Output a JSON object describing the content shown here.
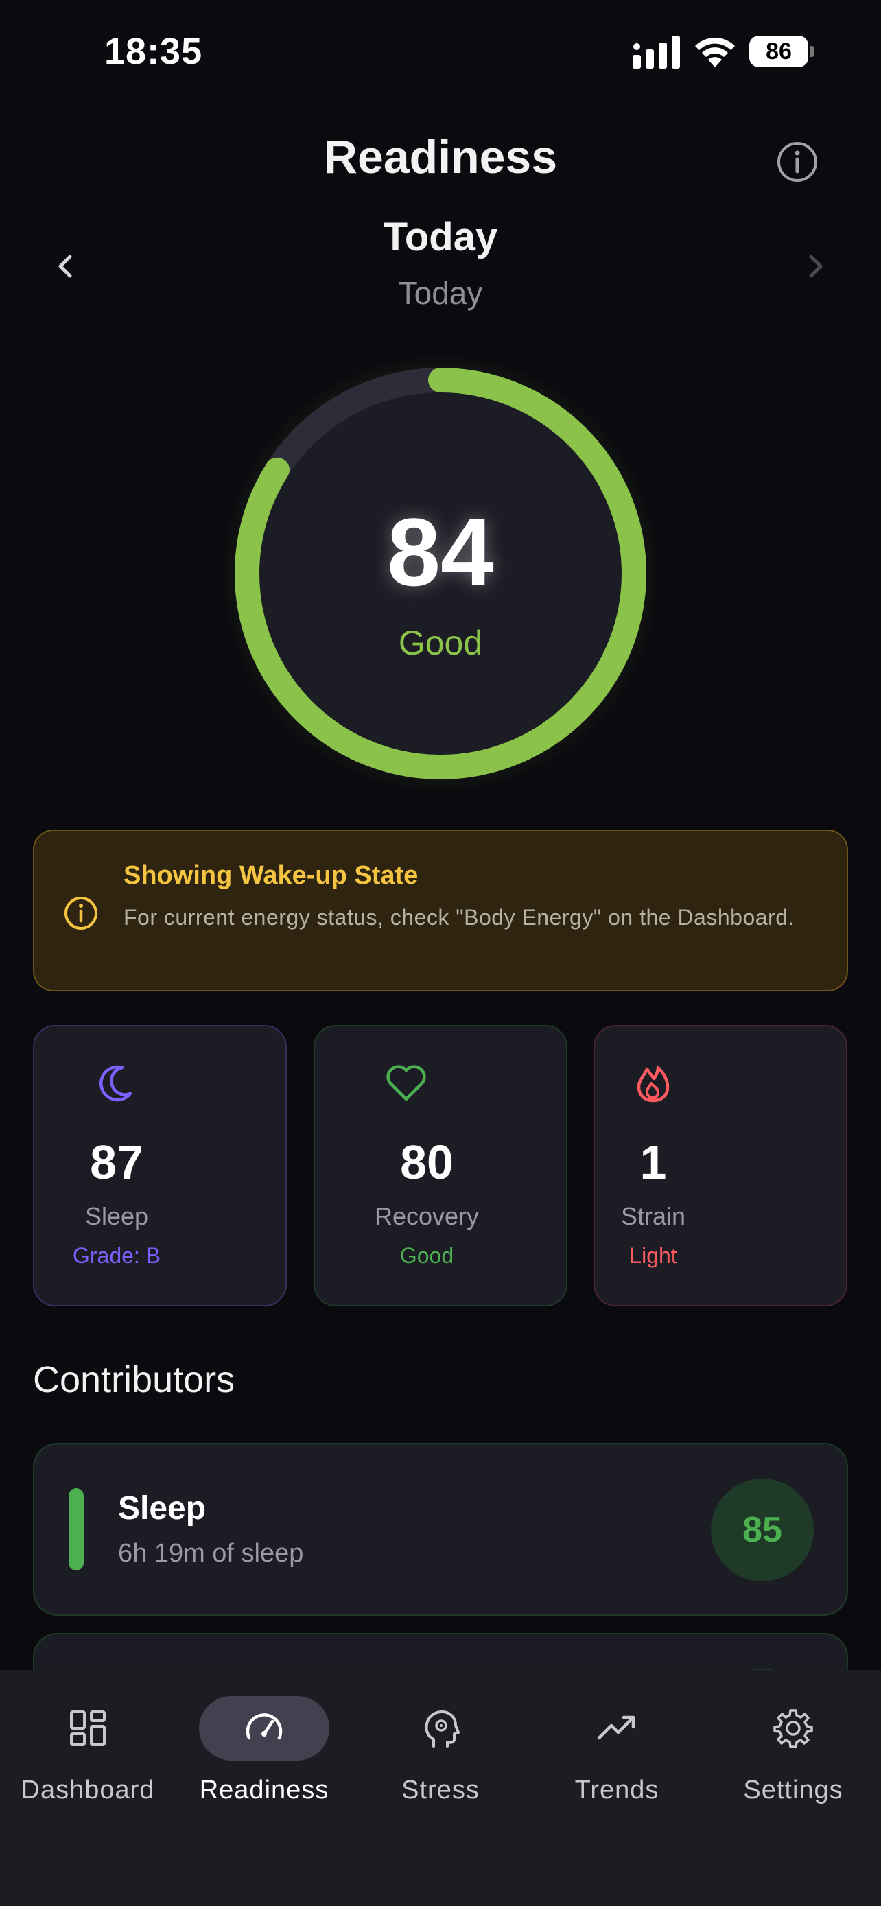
{
  "status_bar": {
    "time": "18:35",
    "battery": "86"
  },
  "header": {
    "title": "Readiness",
    "info_icon": "info-icon"
  },
  "date_nav": {
    "title": "Today",
    "subtitle": "Today"
  },
  "gauge": {
    "score": "84",
    "label": "Good",
    "fraction": 0.84,
    "color": "#8bc34a"
  },
  "notice": {
    "title": "Showing Wake-up State",
    "text": "For current energy status, check \"Body Energy\" on the Dashboard.",
    "color": "#f5c542"
  },
  "metrics": [
    {
      "icon": "moon-icon",
      "value": "87",
      "label": "Sleep",
      "grade": "Grade: B",
      "color": "#7b61ff"
    },
    {
      "icon": "heart-icon",
      "value": "80",
      "label": "Recovery",
      "grade": "Good",
      "color": "#4caf50"
    },
    {
      "icon": "flame-icon",
      "value": "1",
      "label": "Strain",
      "grade": "Light",
      "color": "#ff5a5f"
    }
  ],
  "contributors": {
    "title": "Contributors",
    "items": [
      {
        "title": "Sleep",
        "subtitle": "6h 19m of sleep",
        "score": "85",
        "color": "#4caf50"
      }
    ]
  },
  "tabs": [
    {
      "label": "Dashboard",
      "icon": "dashboard-icon",
      "active": false
    },
    {
      "label": "Readiness",
      "icon": "speedometer-icon",
      "active": true
    },
    {
      "label": "Stress",
      "icon": "brain-icon",
      "active": false
    },
    {
      "label": "Trends",
      "icon": "trending-up-icon",
      "active": false
    },
    {
      "label": "Settings",
      "icon": "gear-icon",
      "active": false
    }
  ]
}
